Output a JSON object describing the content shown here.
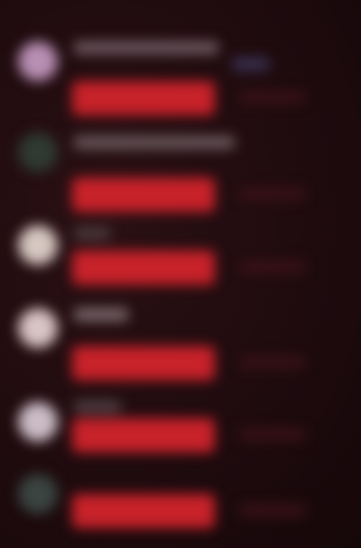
{
  "panel": {
    "title": ""
  },
  "rows": [
    {
      "name": "",
      "tag": "",
      "action_label": "",
      "avatar_color": "#b88fb4",
      "status": ""
    },
    {
      "name": "",
      "tag": "",
      "action_label": "",
      "avatar_color": "#2f3a33",
      "status": ""
    },
    {
      "name": "",
      "tag": "",
      "action_label": "",
      "avatar_color": "#d6c7c1",
      "status": ""
    },
    {
      "name": "",
      "tag": "",
      "action_label": "",
      "avatar_color": "#d8c4c4",
      "status": ""
    },
    {
      "name": "",
      "tag": "",
      "action_label": "",
      "avatar_color": "#cbbcc6",
      "status": ""
    },
    {
      "name": "",
      "tag": "",
      "action_label": "",
      "avatar_color": "#3a4441",
      "status": ""
    }
  ],
  "colors": {
    "background": "#1f0c10",
    "accent": "#c8222a"
  }
}
